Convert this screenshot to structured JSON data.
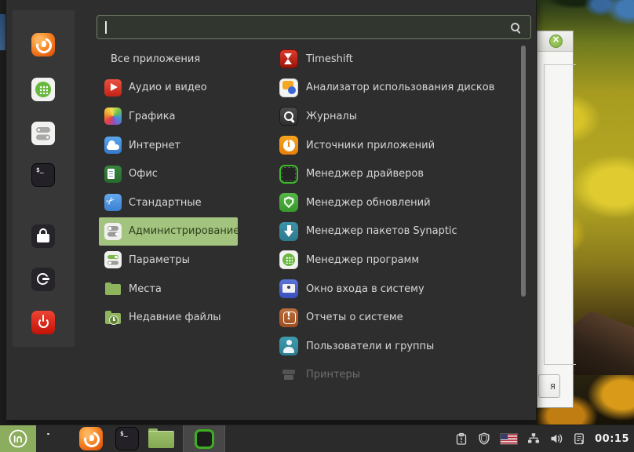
{
  "menu": {
    "search": {
      "value": "",
      "placeholder": ""
    },
    "favorites": [
      {
        "name": "firefox"
      },
      {
        "name": "software-manager"
      },
      {
        "name": "system-settings"
      },
      {
        "name": "terminal"
      },
      {
        "name": "lock-screen"
      },
      {
        "name": "logout"
      },
      {
        "name": "shutdown"
      }
    ],
    "categories": [
      {
        "label": "Все приложения"
      },
      {
        "label": "Аудио и видео"
      },
      {
        "label": "Графика"
      },
      {
        "label": "Интернет"
      },
      {
        "label": "Офис"
      },
      {
        "label": "Стандартные"
      },
      {
        "label": "Администрирование",
        "selected": true
      },
      {
        "label": "Параметры"
      },
      {
        "label": "Места"
      },
      {
        "label": "Недавние файлы"
      }
    ],
    "apps": [
      {
        "label": "Timeshift"
      },
      {
        "label": "Анализатор использования дисков"
      },
      {
        "label": "Журналы"
      },
      {
        "label": "Источники приложений"
      },
      {
        "label": "Менеджер драйверов"
      },
      {
        "label": "Менеджер обновлений"
      },
      {
        "label": "Менеджер пакетов Synaptic"
      },
      {
        "label": "Менеджер программ"
      },
      {
        "label": "Окно входа в систему"
      },
      {
        "label": "Отчеты о системе"
      },
      {
        "label": "Пользователи и группы"
      },
      {
        "label": "Принтеры",
        "disabled": true
      }
    ]
  },
  "background_window": {
    "partial_button_text": "я"
  },
  "panel": {
    "clock": "00:15",
    "launchers": [
      {
        "name": "show-desktop"
      },
      {
        "name": "firefox"
      },
      {
        "name": "terminal"
      },
      {
        "name": "files"
      }
    ],
    "window_list": [
      {
        "name": "driver-manager-window"
      }
    ],
    "tray": [
      {
        "name": "system-reports"
      },
      {
        "name": "update-manager-shield"
      },
      {
        "name": "keyboard-layout-us-flag"
      },
      {
        "name": "network"
      },
      {
        "name": "volume"
      },
      {
        "name": "notes"
      }
    ]
  },
  "colors": {
    "selection_green": "#a2c47e",
    "panel_menu_green": "#8cac5e",
    "window_close_green": "#8cbb4d",
    "power_red": "#d8170b"
  }
}
